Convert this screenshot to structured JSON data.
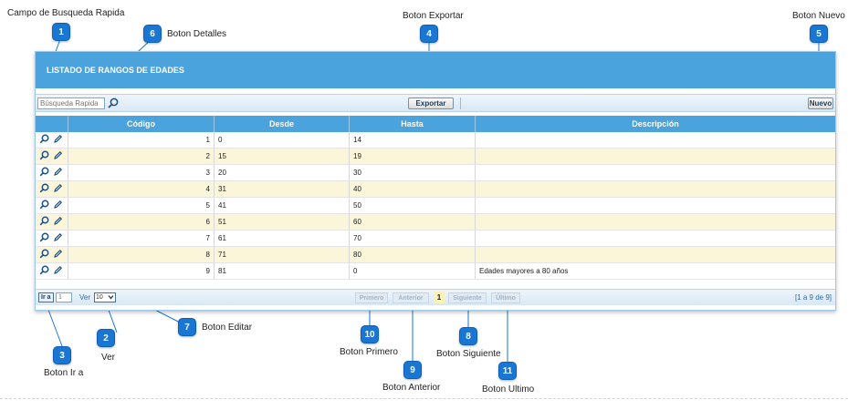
{
  "callouts": {
    "c1_label": "Campo de Busqueda Rapida",
    "c6_label": "Boton Detalles",
    "c4_label": "Boton Exportar",
    "c5_label": "Boton Nuevo",
    "c7_label": "Boton Editar",
    "c2_label": "Ver",
    "c3_label": "Boton Ir a",
    "c10_label": "Boton Primero",
    "c9_label": "Boton Anterior",
    "c8_label": "Boton Siguiente",
    "c11_label": "Boton Ultimo",
    "n1": "1",
    "n2": "2",
    "n3": "3",
    "n4": "4",
    "n5": "5",
    "n6": "6",
    "n7": "7",
    "n8": "8",
    "n9": "9",
    "n10": "10",
    "n11": "11"
  },
  "panel": {
    "title": "LISTADO DE RANGOS DE EDADES"
  },
  "toolbar": {
    "search_placeholder": "Búsqueda Rapida",
    "export_label": "Exportar",
    "new_label": "Nuevo"
  },
  "grid": {
    "headers": {
      "code": "Código",
      "from": "Desde",
      "to": "Hasta",
      "desc": "Descripción"
    },
    "rows": [
      {
        "code": "1",
        "from": "0",
        "to": "14",
        "desc": ""
      },
      {
        "code": "2",
        "from": "15",
        "to": "19",
        "desc": ""
      },
      {
        "code": "3",
        "from": "20",
        "to": "30",
        "desc": ""
      },
      {
        "code": "4",
        "from": "31",
        "to": "40",
        "desc": ""
      },
      {
        "code": "5",
        "from": "41",
        "to": "50",
        "desc": ""
      },
      {
        "code": "6",
        "from": "51",
        "to": "60",
        "desc": ""
      },
      {
        "code": "7",
        "from": "61",
        "to": "70",
        "desc": ""
      },
      {
        "code": "8",
        "from": "71",
        "to": "80",
        "desc": ""
      },
      {
        "code": "9",
        "from": "81",
        "to": "0",
        "desc": "Edades mayores a 80 años"
      }
    ]
  },
  "pager": {
    "goto_label": "Ir a",
    "goto_value": "1",
    "ver_label": "Ver",
    "ver_value": "10",
    "first_label": "Primero",
    "prev_label": "Anterior",
    "current_page": "1",
    "next_label": "Siguiente",
    "last_label": "Último",
    "info": "[1 a 9 de 9]"
  },
  "colors": {
    "accent": "#4aa3dc",
    "badge": "#1976d2",
    "row_alt": "#fbf5d9"
  }
}
